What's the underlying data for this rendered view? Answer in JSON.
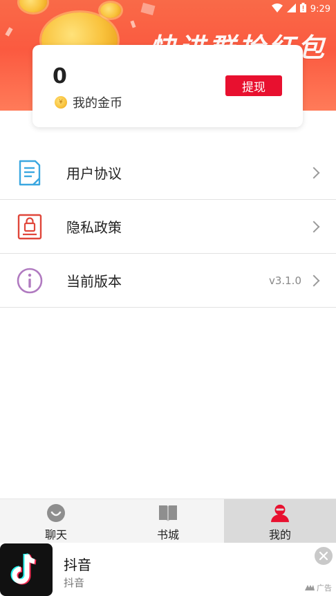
{
  "status_bar": {
    "time": "9:29",
    "icons": [
      "wifi-icon",
      "signal-icon",
      "battery-icon"
    ]
  },
  "banner": {
    "slogan": "快进群抢红包"
  },
  "coin_card": {
    "count": "0",
    "label": "我的金币",
    "coin_symbol": "¥",
    "withdraw_label": "提现",
    "accent_color": "#e8102f"
  },
  "menu": {
    "items": [
      {
        "label": "用户协议",
        "value": "",
        "icon": "document-icon",
        "icon_color": "#3aa7e0"
      },
      {
        "label": "隐私政策",
        "value": "",
        "icon": "lock-icon",
        "icon_color": "#e0463a"
      },
      {
        "label": "当前版本",
        "value": "v3.1.0",
        "icon": "info-icon",
        "icon_color": "#b07ac0"
      }
    ]
  },
  "bottom_nav": {
    "tabs": [
      {
        "label": "聊天",
        "icon": "chat-icon",
        "active": false
      },
      {
        "label": "书城",
        "icon": "book-icon",
        "active": false
      },
      {
        "label": "我的",
        "icon": "profile-icon",
        "active": true
      }
    ],
    "active_color": "#e8102f"
  },
  "ad": {
    "title": "抖音",
    "subtitle": "抖音",
    "tag": "广告",
    "logo_icon": "tiktok-logo-icon"
  }
}
